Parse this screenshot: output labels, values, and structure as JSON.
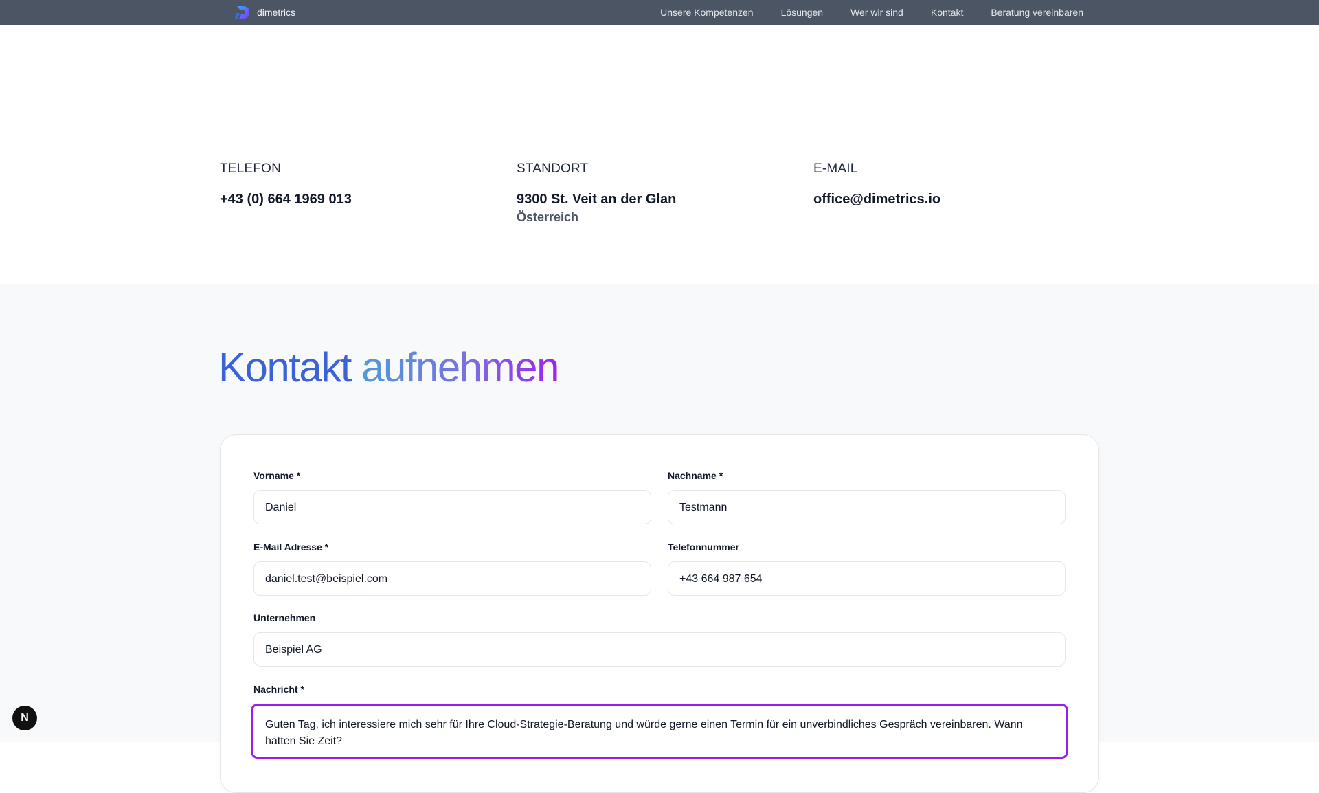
{
  "nav": {
    "brand": "dimetrics",
    "links": [
      "Unsere Kompetenzen",
      "Lösungen",
      "Wer wir sind",
      "Kontakt",
      "Beratung vereinbaren"
    ]
  },
  "contact_info": {
    "phone": {
      "label": "TELEFON",
      "value": "+43 (0) 664 1969 013"
    },
    "location": {
      "label": "STANDORT",
      "value": "9300 St. Veit an der Glan",
      "sub": "Österreich"
    },
    "email": {
      "label": "E-MAIL",
      "value": "office@dimetrics.io"
    }
  },
  "form": {
    "title_part1": "Kontakt",
    "title_part2": "aufnehmen",
    "fields": {
      "vorname": {
        "label": "Vorname *",
        "value": "Daniel"
      },
      "nachname": {
        "label": "Nachname *",
        "value": "Testmann"
      },
      "email": {
        "label": "E-Mail Adresse *",
        "value": "daniel.test@beispiel.com"
      },
      "telefon": {
        "label": "Telefonnummer",
        "value": "+43 664 987 654"
      },
      "unternehmen": {
        "label": "Unternehmen",
        "value": "Beispiel AG"
      },
      "nachricht": {
        "label": "Nachricht *",
        "value": "Guten Tag, ich interessiere mich sehr für Ihre Cloud-Strategie-Beratung und würde gerne einen Termin für ein unverbindliches Gespräch vereinbaren. Wann hätten Sie Zeit?"
      }
    }
  },
  "dev_indicator": {
    "letter": "N"
  },
  "colors": {
    "nav_bg": "#4b5563",
    "accent": "#3b63d6",
    "focus": "#9b1cf0",
    "section_bg": "#f8f9fb"
  }
}
